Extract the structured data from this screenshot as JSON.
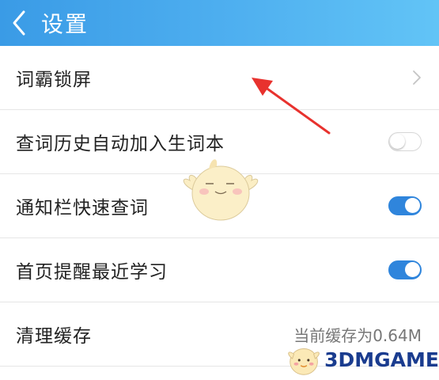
{
  "header": {
    "title": "设置",
    "back_icon": "chevron-left-icon"
  },
  "settings": {
    "lock_screen": {
      "label": "词霸锁屏",
      "icon": "chevron-right-icon"
    },
    "auto_add_history": {
      "label": "查词历史自动加入生词本",
      "enabled": false
    },
    "notification_lookup": {
      "label": "通知栏快速查词",
      "enabled": true
    },
    "home_reminder": {
      "label": "首页提醒最近学习",
      "enabled": true
    },
    "clear_cache": {
      "label": "清理缓存",
      "value": "当前缓存为0.64M"
    }
  },
  "watermark": {
    "text": "3DMGAME"
  },
  "colors": {
    "header_start": "#3a9be6",
    "header_end": "#62c4f6",
    "toggle_on": "#2f85dc",
    "annotation_arrow": "#e8322e"
  }
}
